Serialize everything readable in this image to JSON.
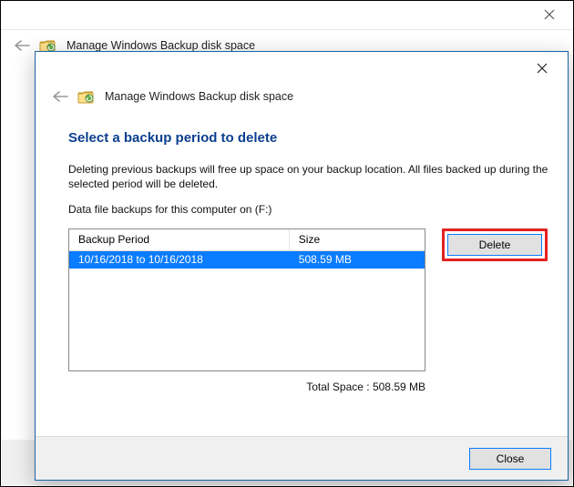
{
  "parent": {
    "title": "Manage Windows Backup disk space"
  },
  "dialog": {
    "header": "Manage Windows Backup disk space",
    "heading": "Select a backup period to delete",
    "desc": "Deleting previous backups will free up space on your backup location. All files backed up during the selected period will be deleted.",
    "subdesc": "Data file backups for this computer on (F:)",
    "table": {
      "columns": {
        "period": "Backup Period",
        "size": "Size"
      },
      "rows": [
        {
          "period": "10/16/2018 to 10/16/2018",
          "size": "508.59 MB"
        }
      ]
    },
    "total": "Total Space : 508.59 MB",
    "delete_label": "Delete",
    "close_label": "Close"
  }
}
